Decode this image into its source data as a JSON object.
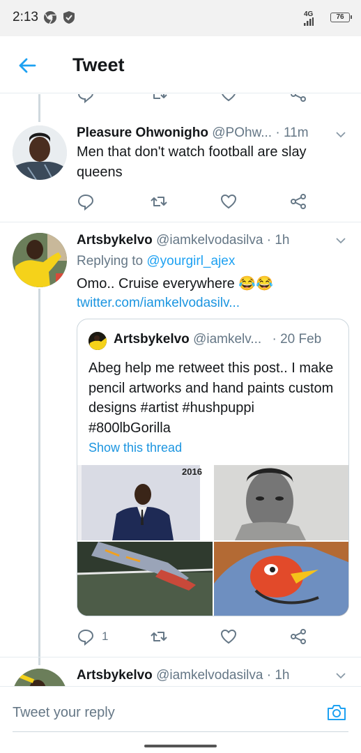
{
  "status": {
    "time": "2:13",
    "network": "4G",
    "battery": "76"
  },
  "header": {
    "title": "Tweet"
  },
  "tweets": [
    {
      "name": "Pleasure Ohwonigho",
      "handle": "@POhw...",
      "time": "· 11m",
      "text": "Men that don't watch football are slay queens"
    },
    {
      "name": "Artsbykelvo",
      "handle": "@iamkelvodasilva",
      "time": "· 1h",
      "replying_prefix": "Replying to ",
      "replying_handle": "@yourgirl_ajex",
      "text": "Omo.. Cruise everywhere 😂😂",
      "link": "twitter.com/iamkelvodasilv...",
      "reply_count": "1",
      "quote": {
        "name": "Artsbykelvo",
        "handle": "@iamkelv...",
        "time": "· 20 Feb",
        "text": "Abeg help me retweet this post..     I make pencil artworks and hand paints custom designs #artist #hushpuppi #800lbGorilla",
        "show_thread": "Show this thread",
        "image_year": "2016"
      }
    },
    {
      "name": "Artsbykelvo",
      "handle": "@iamkelvodasilva",
      "time": "· 1h"
    }
  ],
  "reply": {
    "placeholder": "Tweet your reply"
  }
}
